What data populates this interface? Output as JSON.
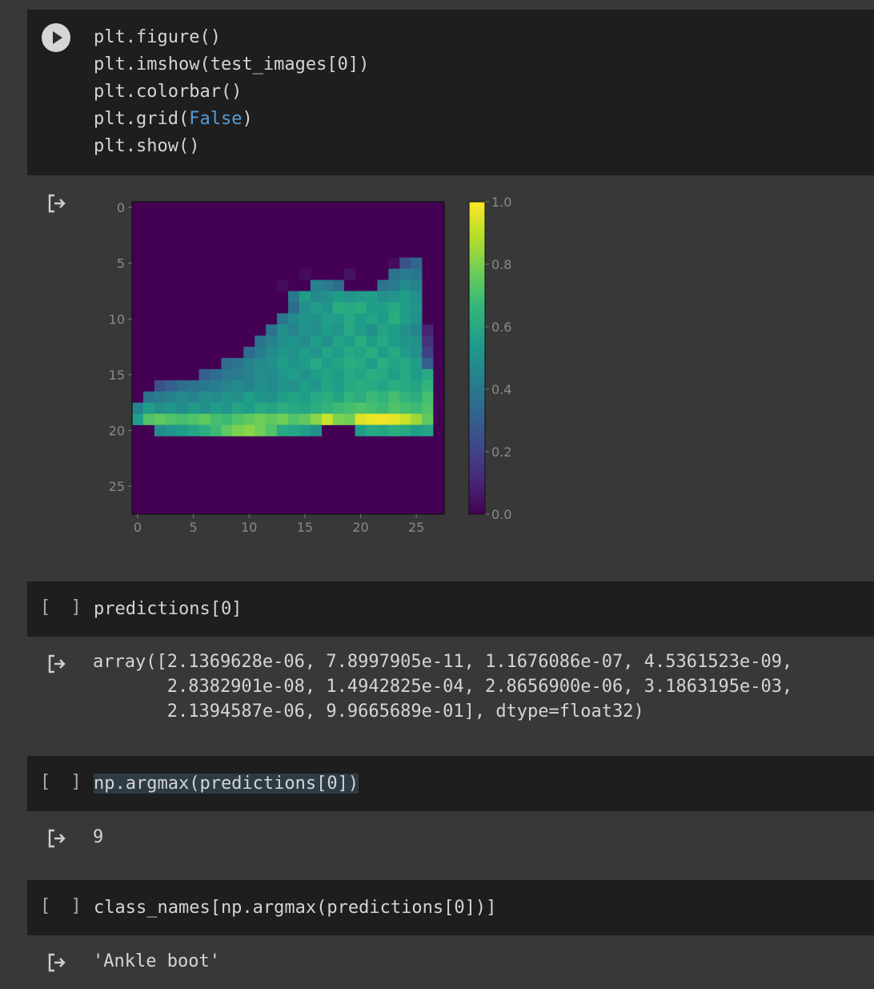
{
  "cells": [
    {
      "type": "code",
      "lines": [
        "plt.figure()",
        "plt.imshow(test_images[0])",
        "plt.colorbar()",
        "plt.grid(",
        "False",
        ")",
        "plt.show()"
      ]
    },
    {
      "type": "code",
      "bracket": "[ ]",
      "source": "predictions[0]",
      "output_lines": [
        "array([2.1369628e-06, 7.8997905e-11, 1.1676086e-07, 4.5361523e-09,",
        "       2.8382901e-08, 1.4942825e-04, 2.8656900e-06, 3.1863195e-03,",
        "       2.1394587e-06, 9.9665689e-01], dtype=float32)"
      ]
    },
    {
      "type": "code",
      "bracket": "[ ]",
      "source": "np.argmax(predictions[0])",
      "output": "9"
    },
    {
      "type": "code",
      "bracket": "[ ]",
      "source": "class_names[np.argmax(predictions[0])]",
      "output": "'Ankle boot'"
    }
  ],
  "chart_data": {
    "type": "heatmap",
    "title": "",
    "xlabel": "",
    "ylabel": "",
    "xlim": [
      -0.5,
      27.5
    ],
    "ylim": [
      27.5,
      -0.5
    ],
    "x_ticks": [
      "0",
      "5",
      "10",
      "15",
      "20",
      "25"
    ],
    "y_ticks": [
      "0",
      "5",
      "10",
      "15",
      "20",
      "25"
    ],
    "colorbar_ticks": [
      "0.0",
      "0.2",
      "0.4",
      "0.6",
      "0.8",
      "1.0"
    ],
    "colormap": "viridis",
    "grid": false,
    "rows_with_ink": [
      {
        "row": 5,
        "values": [
          [
            23,
            0.03
          ],
          [
            24,
            0.25
          ],
          [
            25,
            0.33
          ]
        ]
      },
      {
        "row": 6,
        "values": [
          [
            15,
            0.03
          ],
          [
            19,
            0.05
          ],
          [
            23,
            0.38
          ],
          [
            24,
            0.42
          ],
          [
            25,
            0.4
          ]
        ]
      },
      {
        "row": 7,
        "values": [
          [
            13,
            0.03
          ],
          [
            16,
            0.45
          ],
          [
            17,
            0.42
          ],
          [
            18,
            0.35
          ],
          [
            22,
            0.38
          ],
          [
            23,
            0.42
          ],
          [
            24,
            0.48
          ],
          [
            25,
            0.45
          ]
        ]
      },
      {
        "row": 8,
        "values": [
          [
            14,
            0.4
          ],
          [
            15,
            0.55
          ],
          [
            16,
            0.47
          ],
          [
            17,
            0.5
          ],
          [
            18,
            0.55
          ],
          [
            19,
            0.52
          ],
          [
            20,
            0.55
          ],
          [
            21,
            0.56
          ],
          [
            22,
            0.5
          ],
          [
            23,
            0.52
          ],
          [
            24,
            0.55
          ],
          [
            25,
            0.5
          ]
        ]
      },
      {
        "row": 9,
        "values": [
          [
            14,
            0.35
          ],
          [
            15,
            0.5
          ],
          [
            16,
            0.55
          ],
          [
            17,
            0.52
          ],
          [
            18,
            0.62
          ],
          [
            19,
            0.6
          ],
          [
            20,
            0.62
          ],
          [
            21,
            0.55
          ],
          [
            22,
            0.56
          ],
          [
            23,
            0.6
          ],
          [
            24,
            0.55
          ],
          [
            25,
            0.52
          ]
        ]
      },
      {
        "row": 10,
        "values": [
          [
            13,
            0.4
          ],
          [
            14,
            0.48
          ],
          [
            15,
            0.52
          ],
          [
            16,
            0.5
          ],
          [
            17,
            0.56
          ],
          [
            18,
            0.55
          ],
          [
            19,
            0.6
          ],
          [
            20,
            0.55
          ],
          [
            21,
            0.58
          ],
          [
            22,
            0.55
          ],
          [
            23,
            0.62
          ],
          [
            24,
            0.55
          ],
          [
            25,
            0.5
          ]
        ]
      },
      {
        "row": 11,
        "values": [
          [
            12,
            0.38
          ],
          [
            13,
            0.5
          ],
          [
            14,
            0.45
          ],
          [
            15,
            0.52
          ],
          [
            16,
            0.5
          ],
          [
            17,
            0.55
          ],
          [
            18,
            0.52
          ],
          [
            19,
            0.6
          ],
          [
            20,
            0.55
          ],
          [
            21,
            0.5
          ],
          [
            22,
            0.58
          ],
          [
            23,
            0.55
          ],
          [
            24,
            0.5
          ],
          [
            25,
            0.45
          ],
          [
            26,
            0.1
          ]
        ]
      },
      {
        "row": 12,
        "values": [
          [
            11,
            0.38
          ],
          [
            12,
            0.45
          ],
          [
            13,
            0.5
          ],
          [
            14,
            0.52
          ],
          [
            15,
            0.48
          ],
          [
            16,
            0.55
          ],
          [
            17,
            0.5
          ],
          [
            18,
            0.58
          ],
          [
            19,
            0.55
          ],
          [
            20,
            0.62
          ],
          [
            21,
            0.55
          ],
          [
            22,
            0.6
          ],
          [
            23,
            0.55
          ],
          [
            24,
            0.52
          ],
          [
            25,
            0.5
          ],
          [
            26,
            0.15
          ]
        ]
      },
      {
        "row": 13,
        "values": [
          [
            10,
            0.35
          ],
          [
            11,
            0.42
          ],
          [
            12,
            0.48
          ],
          [
            13,
            0.52
          ],
          [
            14,
            0.5
          ],
          [
            15,
            0.55
          ],
          [
            16,
            0.52
          ],
          [
            17,
            0.58
          ],
          [
            18,
            0.55
          ],
          [
            19,
            0.6
          ],
          [
            20,
            0.58
          ],
          [
            21,
            0.62
          ],
          [
            22,
            0.55
          ],
          [
            23,
            0.6
          ],
          [
            24,
            0.55
          ],
          [
            25,
            0.5
          ],
          [
            26,
            0.2
          ]
        ]
      },
      {
        "row": 14,
        "values": [
          [
            8,
            0.35
          ],
          [
            9,
            0.38
          ],
          [
            10,
            0.45
          ],
          [
            11,
            0.48
          ],
          [
            12,
            0.5
          ],
          [
            13,
            0.55
          ],
          [
            14,
            0.52
          ],
          [
            15,
            0.55
          ],
          [
            16,
            0.6
          ],
          [
            17,
            0.55
          ],
          [
            18,
            0.58
          ],
          [
            19,
            0.62
          ],
          [
            20,
            0.6
          ],
          [
            21,
            0.55
          ],
          [
            22,
            0.62
          ],
          [
            23,
            0.58
          ],
          [
            24,
            0.6
          ],
          [
            25,
            0.55
          ],
          [
            26,
            0.3
          ]
        ]
      },
      {
        "row": 15,
        "values": [
          [
            6,
            0.3
          ],
          [
            7,
            0.35
          ],
          [
            8,
            0.4
          ],
          [
            9,
            0.42
          ],
          [
            10,
            0.45
          ],
          [
            11,
            0.5
          ],
          [
            12,
            0.48
          ],
          [
            13,
            0.52
          ],
          [
            14,
            0.55
          ],
          [
            15,
            0.5
          ],
          [
            16,
            0.55
          ],
          [
            17,
            0.58
          ],
          [
            18,
            0.55
          ],
          [
            19,
            0.6
          ],
          [
            20,
            0.58
          ],
          [
            21,
            0.62
          ],
          [
            22,
            0.6
          ],
          [
            23,
            0.55
          ],
          [
            24,
            0.6
          ],
          [
            25,
            0.55
          ],
          [
            26,
            0.6
          ]
        ]
      },
      {
        "row": 16,
        "values": [
          [
            2,
            0.25
          ],
          [
            3,
            0.3
          ],
          [
            4,
            0.35
          ],
          [
            5,
            0.38
          ],
          [
            6,
            0.4
          ],
          [
            7,
            0.42
          ],
          [
            8,
            0.45
          ],
          [
            9,
            0.48
          ],
          [
            10,
            0.45
          ],
          [
            11,
            0.5
          ],
          [
            12,
            0.48
          ],
          [
            13,
            0.52
          ],
          [
            14,
            0.5
          ],
          [
            15,
            0.55
          ],
          [
            16,
            0.52
          ],
          [
            17,
            0.58
          ],
          [
            18,
            0.55
          ],
          [
            19,
            0.6
          ],
          [
            20,
            0.62
          ],
          [
            21,
            0.6
          ],
          [
            22,
            0.58
          ],
          [
            23,
            0.62
          ],
          [
            24,
            0.6
          ],
          [
            25,
            0.58
          ],
          [
            26,
            0.65
          ]
        ]
      },
      {
        "row": 17,
        "values": [
          [
            1,
            0.38
          ],
          [
            2,
            0.42
          ],
          [
            3,
            0.45
          ],
          [
            4,
            0.48
          ],
          [
            5,
            0.45
          ],
          [
            6,
            0.5
          ],
          [
            7,
            0.48
          ],
          [
            8,
            0.52
          ],
          [
            9,
            0.5
          ],
          [
            10,
            0.55
          ],
          [
            11,
            0.52
          ],
          [
            12,
            0.5
          ],
          [
            13,
            0.55
          ],
          [
            14,
            0.58
          ],
          [
            15,
            0.55
          ],
          [
            16,
            0.6
          ],
          [
            17,
            0.62
          ],
          [
            18,
            0.58
          ],
          [
            19,
            0.65
          ],
          [
            20,
            0.62
          ],
          [
            21,
            0.68
          ],
          [
            22,
            0.65
          ],
          [
            23,
            0.7
          ],
          [
            24,
            0.65
          ],
          [
            25,
            0.62
          ],
          [
            26,
            0.7
          ]
        ]
      },
      {
        "row": 18,
        "values": [
          [
            0,
            0.45
          ],
          [
            1,
            0.55
          ],
          [
            2,
            0.5
          ],
          [
            3,
            0.52
          ],
          [
            4,
            0.48
          ],
          [
            5,
            0.55
          ],
          [
            6,
            0.5
          ],
          [
            7,
            0.55
          ],
          [
            8,
            0.52
          ],
          [
            9,
            0.58
          ],
          [
            10,
            0.55
          ],
          [
            11,
            0.6
          ],
          [
            12,
            0.58
          ],
          [
            13,
            0.62
          ],
          [
            14,
            0.6
          ],
          [
            15,
            0.58
          ],
          [
            16,
            0.62
          ],
          [
            17,
            0.65
          ],
          [
            18,
            0.68
          ],
          [
            19,
            0.7
          ],
          [
            20,
            0.72
          ],
          [
            21,
            0.7
          ],
          [
            22,
            0.68
          ],
          [
            23,
            0.72
          ],
          [
            24,
            0.7
          ],
          [
            25,
            0.68
          ],
          [
            26,
            0.72
          ]
        ]
      },
      {
        "row": 19,
        "values": [
          [
            0,
            0.55
          ],
          [
            1,
            0.72
          ],
          [
            2,
            0.75
          ],
          [
            3,
            0.72
          ],
          [
            4,
            0.7
          ],
          [
            5,
            0.72
          ],
          [
            6,
            0.75
          ],
          [
            7,
            0.7
          ],
          [
            8,
            0.68
          ],
          [
            9,
            0.72
          ],
          [
            10,
            0.75
          ],
          [
            11,
            0.78
          ],
          [
            12,
            0.75
          ],
          [
            13,
            0.78
          ],
          [
            14,
            0.72
          ],
          [
            15,
            0.75
          ],
          [
            16,
            0.82
          ],
          [
            17,
            0.92
          ],
          [
            18,
            0.8
          ],
          [
            19,
            0.78
          ],
          [
            20,
            0.95
          ],
          [
            21,
            0.97
          ],
          [
            22,
            0.98
          ],
          [
            23,
            0.96
          ],
          [
            24,
            0.92
          ],
          [
            25,
            0.85
          ],
          [
            26,
            0.75
          ]
        ]
      },
      {
        "row": 20,
        "values": [
          [
            2,
            0.48
          ],
          [
            3,
            0.52
          ],
          [
            4,
            0.55
          ],
          [
            5,
            0.58
          ],
          [
            6,
            0.62
          ],
          [
            7,
            0.68
          ],
          [
            8,
            0.75
          ],
          [
            9,
            0.8
          ],
          [
            10,
            0.82
          ],
          [
            11,
            0.78
          ],
          [
            12,
            0.72
          ],
          [
            13,
            0.6
          ],
          [
            14,
            0.58
          ],
          [
            15,
            0.55
          ],
          [
            16,
            0.5
          ],
          [
            20,
            0.55
          ],
          [
            21,
            0.6
          ],
          [
            22,
            0.58
          ],
          [
            23,
            0.62
          ],
          [
            24,
            0.6
          ],
          [
            25,
            0.55
          ],
          [
            26,
            0.58
          ]
        ]
      }
    ]
  }
}
